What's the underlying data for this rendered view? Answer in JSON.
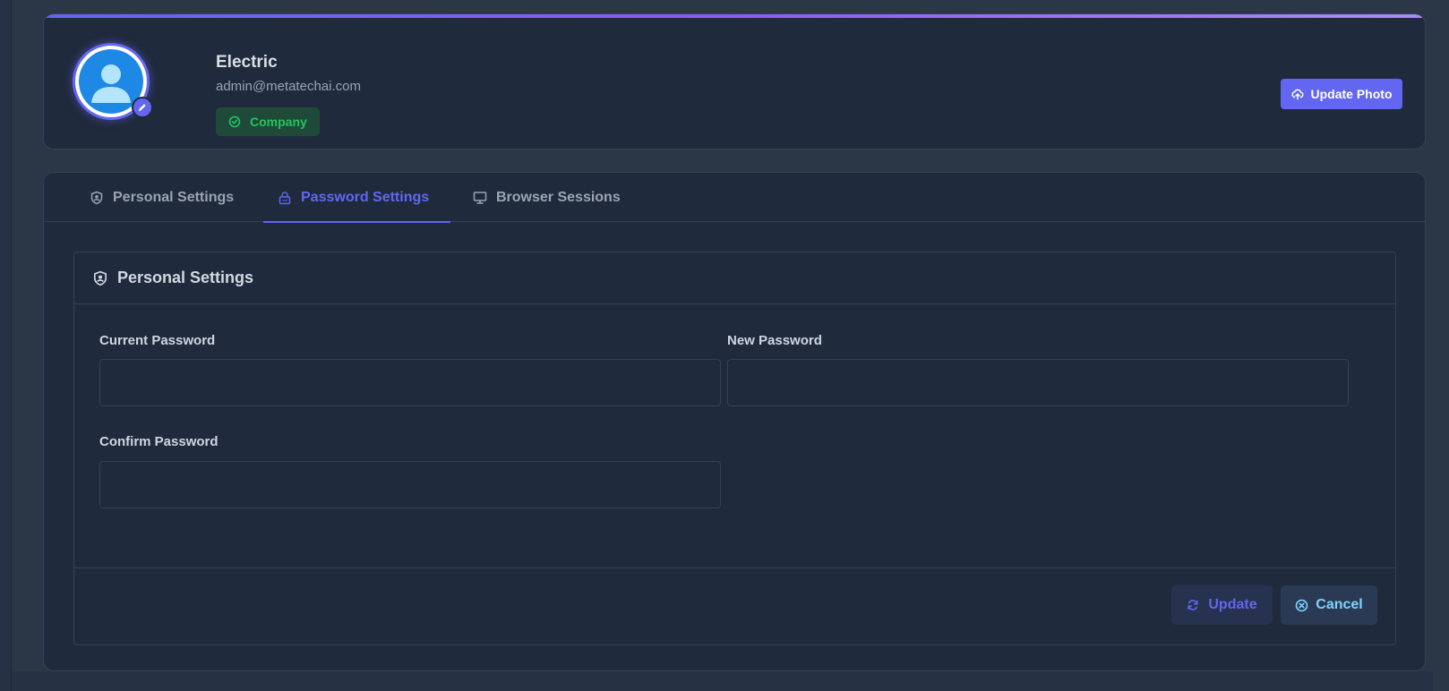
{
  "profile": {
    "name": "Electric",
    "email": "admin@metatechai.com",
    "role_badge": "Company",
    "update_photo_label": "Update Photo"
  },
  "tabs": [
    {
      "label": "Personal Settings",
      "icon": "shield-user-icon",
      "active": false
    },
    {
      "label": "Password Settings",
      "icon": "lock-icon",
      "active": true
    },
    {
      "label": "Browser Sessions",
      "icon": "monitor-icon",
      "active": false
    }
  ],
  "panel": {
    "title": "Personal Settings",
    "fields": {
      "current_password": {
        "label": "Current Password",
        "value": ""
      },
      "new_password": {
        "label": "New Password",
        "value": ""
      },
      "confirm_password": {
        "label": "Confirm Password",
        "value": ""
      }
    },
    "update_label": "Update",
    "cancel_label": "Cancel"
  },
  "colors": {
    "accent": "#6366f1",
    "background": "#2b3647",
    "card": "#1f2a3c",
    "success": "#22c55e",
    "cancel_text": "#7dd3fc"
  }
}
